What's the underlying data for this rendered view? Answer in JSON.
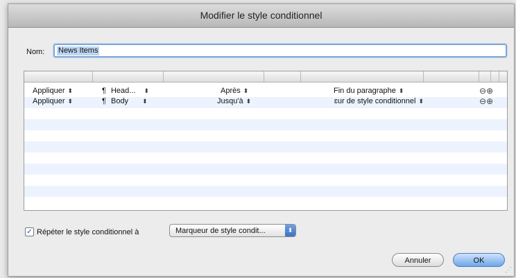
{
  "window": {
    "title": "Modifier le style conditionnel"
  },
  "name_field": {
    "label": "Nom:",
    "value": "News Items"
  },
  "table": {
    "rows": [
      {
        "action": "Appliquer",
        "style": "Head...",
        "range": "Après",
        "end": "Fin du paragraphe"
      },
      {
        "action": "Appliquer",
        "style": "Body",
        "range": "Jusqu'à",
        "end": "ɛur de style conditionnel"
      }
    ],
    "pilcrow": "¶",
    "updown": "⬍",
    "remove_glyph": "⊖",
    "add_glyph": "⊕"
  },
  "repeat": {
    "checked": true,
    "check_glyph": "✓",
    "label": "Répéter le style conditionnel à",
    "popup_value": "Marqueur de style condit...",
    "popup_arrows": "⬍"
  },
  "buttons": {
    "cancel": "Annuler",
    "ok": "OK"
  },
  "resize_glyph": "⋰",
  "colors": {
    "accent": "#3b73c9",
    "row_alt": "#edf3fe",
    "selection": "#bdd5f2"
  }
}
